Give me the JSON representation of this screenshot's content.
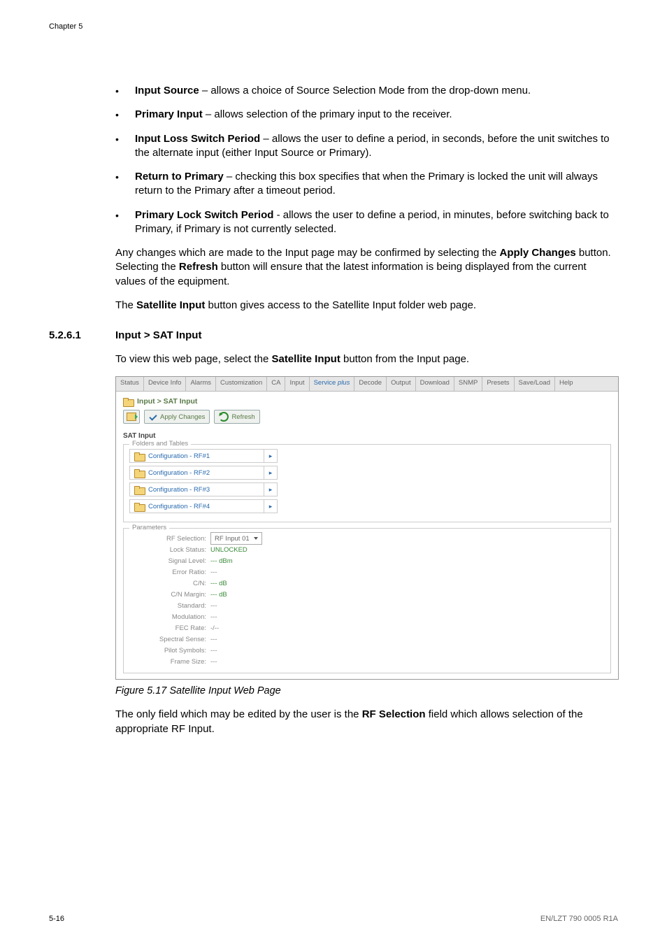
{
  "chapter": "Chapter 5",
  "bullets": [
    {
      "term": "Input Source",
      "desc": " – allows a choice of Source Selection Mode from the drop-down menu."
    },
    {
      "term": "Primary Input",
      "desc": " – allows selection of the primary input to the receiver."
    },
    {
      "term": "Input Loss Switch Period",
      "desc": " – allows the user to define a period, in seconds, before the unit switches to the alternate input (either Input Source or Primary)."
    },
    {
      "term": "Return to Primary",
      "desc": " – checking this box specifies that when the Primary is locked the unit will always return to the Primary after a timeout period."
    },
    {
      "term": "Primary Lock Switch Period",
      "desc": " - allows the user to define a period, in minutes, before switching back to Primary, if Primary is not currently selected."
    }
  ],
  "para1_a": "Any changes which are made to the Input page may be confirmed by selecting the ",
  "para1_b": "Apply Changes",
  "para1_c": " button. Selecting the ",
  "para1_d": "Refresh",
  "para1_e": " button will ensure that the latest information is being displayed from the current values of the equipment.",
  "para2_a": "The ",
  "para2_b": "Satellite Input",
  "para2_c": " button gives access to the Satellite Input folder web page.",
  "section_num": "5.2.6.1",
  "section_title": "Input > SAT Input",
  "para3_a": "To view this web page, select the ",
  "para3_b": "Satellite Input",
  "para3_c": " button from the Input page.",
  "tabs": {
    "status": "Status",
    "device": "Device Info",
    "alarms": "Alarms",
    "custom": "Customization",
    "ca": "CA",
    "input": "Input",
    "service_a": "Service ",
    "service_b": "plus",
    "decode": "Decode",
    "output": "Output",
    "download": "Download",
    "snmp": "SNMP",
    "presets": "Presets",
    "saveload": "Save/Load",
    "help": "Help"
  },
  "crumb": "Input > SAT Input",
  "toolbar": {
    "apply": "Apply Changes",
    "refresh": "Refresh"
  },
  "group_title": "SAT Input",
  "folders_legend": "Folders and Tables",
  "folders": [
    "Configuration - RF#1",
    "Configuration - RF#2",
    "Configuration - RF#3",
    "Configuration - RF#4"
  ],
  "params_legend": "Parameters",
  "rf_selection_label": "RF Selection:",
  "rf_selection_value": "RF Input 01",
  "params": [
    {
      "lab": "Lock Status:",
      "val": "UNLOCKED",
      "green": true
    },
    {
      "lab": "Signal Level:",
      "val": "--- dBm",
      "green": true
    },
    {
      "lab": "Error Ratio:",
      "val": "---"
    },
    {
      "lab": "C/N:",
      "val": "--- dB",
      "green": true
    },
    {
      "lab": "C/N Margin:",
      "val": "--- dB",
      "green": true
    },
    {
      "lab": "Standard:",
      "val": "---"
    },
    {
      "lab": "Modulation:",
      "val": "---"
    },
    {
      "lab": "FEC Rate:",
      "val": "-/--"
    },
    {
      "lab": "Spectral Sense:",
      "val": "---"
    },
    {
      "lab": "Pilot Symbols:",
      "val": "---"
    },
    {
      "lab": "Frame Size:",
      "val": "---"
    }
  ],
  "caption": "Figure 5.17 Satellite Input Web Page",
  "para4_a": "The only field which may be edited by the user is the ",
  "para4_b": "RF Selection",
  "para4_c": " field which allows selection of the appropriate RF Input.",
  "footer_left": "5-16",
  "footer_right": "EN/LZT 790 0005 R1A"
}
